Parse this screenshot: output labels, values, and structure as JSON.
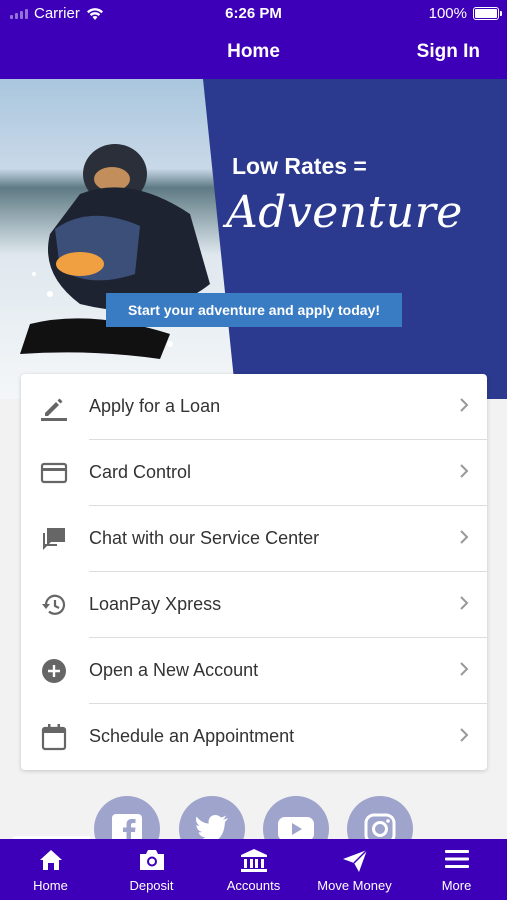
{
  "status_bar": {
    "carrier": "Carrier",
    "time": "6:26 PM",
    "battery": "100%"
  },
  "nav": {
    "title": "Home",
    "sign_in": "Sign In"
  },
  "banner": {
    "headline": "Low Rates =",
    "script_word": "Adventure",
    "cta": "Start your adventure and apply today!"
  },
  "menu": {
    "items": [
      {
        "label": "Apply for a Loan",
        "icon": "pencil-icon"
      },
      {
        "label": "Card Control",
        "icon": "credit-card-icon"
      },
      {
        "label": "Chat with our Service Center",
        "icon": "chat-icon"
      },
      {
        "label": "LoanPay Xpress",
        "icon": "history-icon"
      },
      {
        "label": "Open a New Account",
        "icon": "add-circle-icon"
      },
      {
        "label": "Schedule an Appointment",
        "icon": "calendar-icon"
      }
    ]
  },
  "social": [
    "facebook-icon",
    "twitter-icon",
    "youtube-icon",
    "instagram-icon"
  ],
  "tabs": [
    {
      "label": "Home",
      "icon": "home-icon"
    },
    {
      "label": "Deposit",
      "icon": "camera-icon"
    },
    {
      "label": "Accounts",
      "icon": "bank-icon"
    },
    {
      "label": "Move Money",
      "icon": "send-icon"
    },
    {
      "label": "More",
      "icon": "menu-icon"
    }
  ],
  "colors": {
    "brand": "#3d00b8",
    "banner_bg": "#2b3a8f",
    "cta": "#3a7cc4",
    "social": "#9ea4cc"
  }
}
